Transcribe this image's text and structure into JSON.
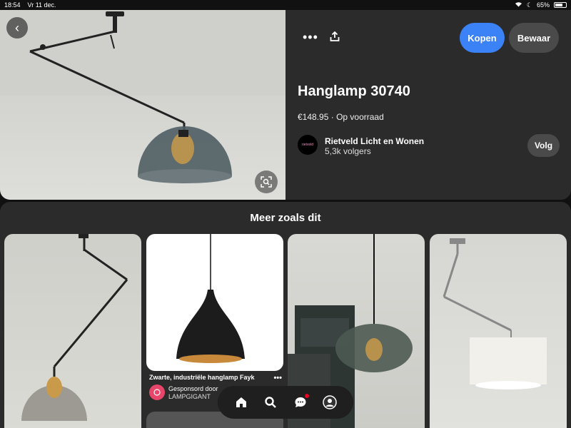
{
  "status_bar": {
    "time": "18:54",
    "date": "Vr 11 dec.",
    "battery": "65%"
  },
  "pin": {
    "title": "Hanglamp 30740",
    "price": "€148.95",
    "availability": "Op voorraad",
    "buy_label": "Kopen",
    "save_label": "Bewaar",
    "store": {
      "name": "Rietveld Licht en Wonen",
      "followers": "5,3k volgers",
      "logo_text": "rietveld"
    },
    "follow_label": "Volg"
  },
  "more_section": {
    "title": "Meer zoals dit",
    "sponsored_pin": {
      "title": "Zwarte, industriële hanglamp Fayk",
      "sponsored_label": "Gesponsord door",
      "brand": "LAMPGIGANT"
    }
  },
  "nav": {
    "items": [
      "home-icon",
      "search-icon",
      "messages-icon",
      "profile-icon"
    ]
  },
  "colors": {
    "accent": "#3b82f6",
    "background": "#2b2b2b",
    "notification": "#e60023"
  }
}
